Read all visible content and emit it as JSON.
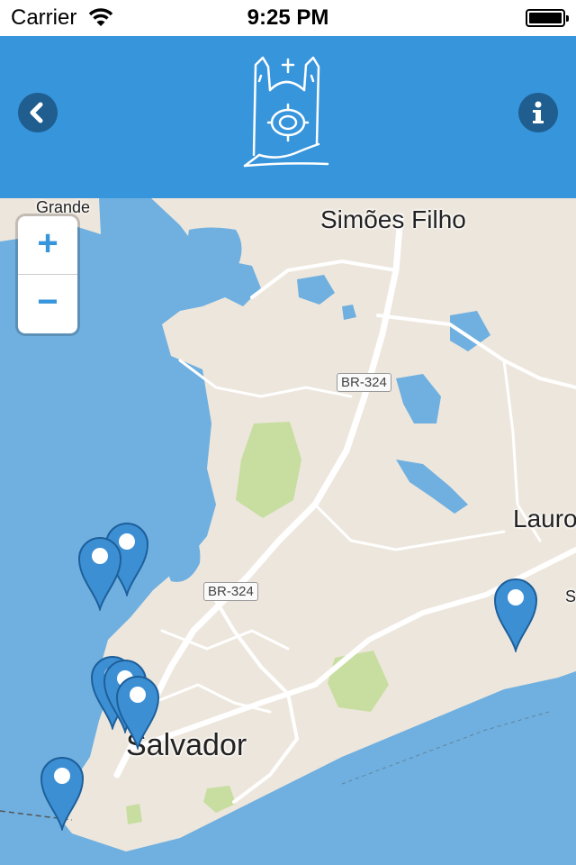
{
  "status_bar": {
    "carrier": "Carrier",
    "time": "9:25 PM",
    "icons": [
      "wifi-icon",
      "battery-icon"
    ]
  },
  "nav_bar": {
    "background": "#3795dc",
    "back_icon": "chevron-left-icon",
    "logo_icon": "church-logo-icon",
    "info_icon": "info-icon"
  },
  "map": {
    "zoom_in_label": "+",
    "zoom_out_label": "−",
    "labels": {
      "grande": "Grande",
      "simoes_filho": "Simões Filho",
      "lauro": "Lauro",
      "salvador": "Salvador",
      "s_fragment": "S"
    },
    "road_shields": [
      "BR-324",
      "BR-324"
    ],
    "colors": {
      "water": "#6fb0e0",
      "land": "#ede6dc",
      "park": "#c7dea0",
      "pin": "#3d8fd4"
    },
    "markers": [
      "location-marker",
      "location-marker",
      "location-marker",
      "location-marker",
      "location-marker",
      "location-marker",
      "location-marker"
    ]
  }
}
